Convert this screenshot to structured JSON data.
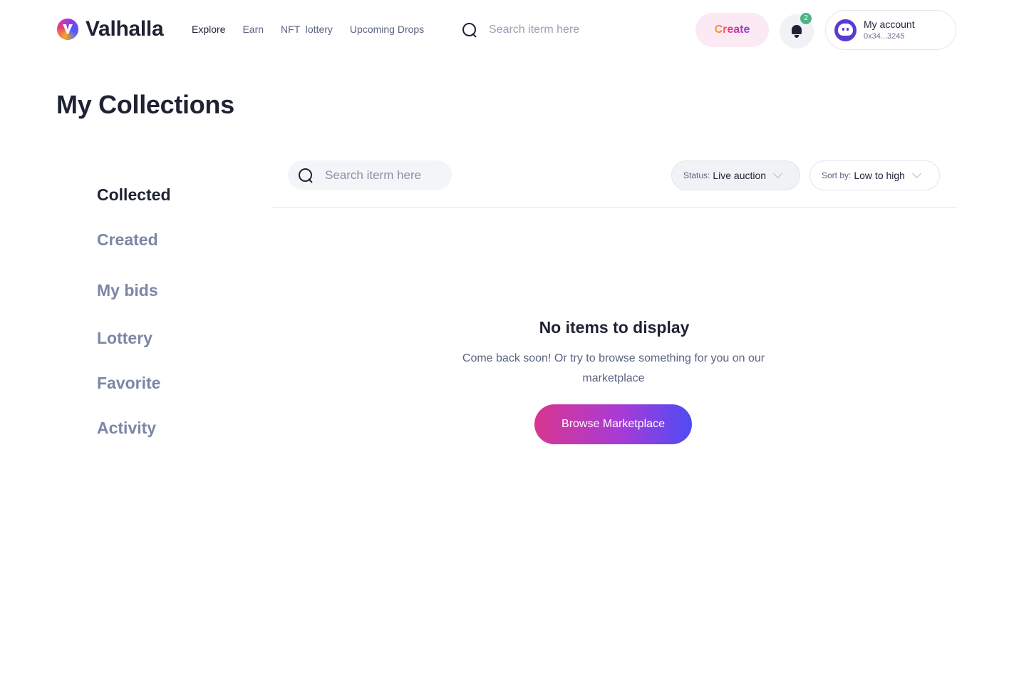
{
  "header": {
    "logo_text": "Valhalla",
    "nav": [
      "Explore",
      "Earn",
      "NFT  lottery",
      "Upcoming Drops"
    ],
    "search_placeholder": "Search iterm here",
    "create_label": "Create",
    "notification_count": "2",
    "account": {
      "name": "My account",
      "address": "0x34...3245"
    }
  },
  "page_title": "My Collections",
  "sidebar": {
    "items": [
      "Collected",
      "Created",
      "My bids",
      "Lottery",
      "Favorite",
      "Activity"
    ],
    "active": "Collected"
  },
  "filters": {
    "search_placeholder": "Search iterm here",
    "status": {
      "label": "Status:",
      "value": "Live auction"
    },
    "sort": {
      "label": "Sort by:",
      "value": "Low to high"
    }
  },
  "empty_state": {
    "title": "No items to display",
    "description": "Come back soon! Or try to browse something for you on our marketplace",
    "button_label": "Browse Marketplace"
  },
  "colors": {
    "text_primary": "#1f2233",
    "text_muted": "#7e86a5",
    "badge": "#4fb286",
    "create_bg": "#fbeaf3",
    "button_gradient": [
      "#d8368f",
      "#a83bd6",
      "#4d4cf5"
    ]
  }
}
